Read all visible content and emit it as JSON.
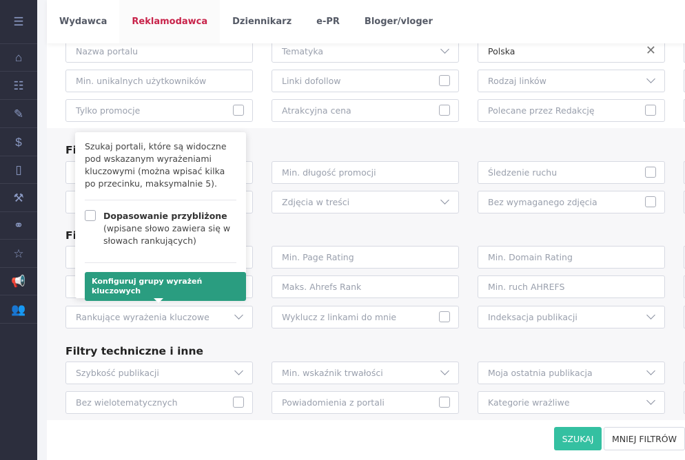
{
  "sidebar": {
    "items": [
      "menu-icon",
      "home-icon",
      "list-icon",
      "edit-icon",
      "invoice-icon",
      "clipboard-icon",
      "magic-wand-icon",
      "link-icon",
      "star-icon",
      "megaphone-icon",
      "users-icon"
    ],
    "glyphs": [
      "☰",
      "⌂",
      "☷",
      "✎",
      "$",
      "▯",
      "⚒",
      "⚭",
      "☆",
      "📢",
      "👥"
    ]
  },
  "tabs": [
    {
      "label": "Wydawca"
    },
    {
      "label": "Reklamodawca",
      "active": true
    },
    {
      "label": "Dziennikarz"
    },
    {
      "label": "e-PR"
    },
    {
      "label": "Bloger/vloger"
    }
  ],
  "accent": "#c8234a",
  "headings": [
    "Fi",
    "Fi",
    "Filtry techniczne i inne"
  ],
  "fields": [
    {
      "p": "Nazwa portalu",
      "c": ""
    },
    {
      "p": "Tematyka",
      "c": "chev"
    },
    {
      "p": "",
      "v": "Polska",
      "c": "clear"
    },
    {
      "p": "Min. unikalnych użytkowników",
      "c": ""
    },
    {
      "p": "Linki dofollow",
      "c": "cb"
    },
    {
      "p": "Rodzaj linków",
      "c": "chev"
    },
    {
      "p": "Tylko promocje",
      "c": "cb"
    },
    {
      "p": "Atrakcyjna cena",
      "c": "cb"
    },
    {
      "p": "Polecane przez Redakcję",
      "c": "cb"
    },
    {
      "p": "",
      "c": ""
    },
    {
      "p": "Min. długość promocji",
      "c": ""
    },
    {
      "p": "Śledzenie ruchu",
      "c": "cb"
    },
    {
      "p": "",
      "c": ""
    },
    {
      "p": "Zdjęcia w treści",
      "c": "chev"
    },
    {
      "p": "Bez wymaganego zdjęcia",
      "c": "cb"
    },
    {
      "p": "",
      "c": ""
    },
    {
      "p": "Min. Page Rating",
      "c": ""
    },
    {
      "p": "Min. Domain Rating",
      "c": ""
    },
    {
      "p": "",
      "c": ""
    },
    {
      "p": "Maks. Ahrefs Rank",
      "c": ""
    },
    {
      "p": "Min. ruch AHREFS",
      "c": ""
    },
    {
      "p": "Rankujące wyrażenia kluczowe",
      "c": "chev"
    },
    {
      "p": "Wyklucz z linkami do mnie",
      "c": "cb"
    },
    {
      "p": "Indeksacja publikacji",
      "c": "chev"
    },
    {
      "p": "Szybkość publikacji",
      "c": "chev"
    },
    {
      "p": "Min. wskaźnik trwałości",
      "c": "chev"
    },
    {
      "p": "Moja ostatnia publikacja",
      "c": "chev"
    },
    {
      "p": "Bez wielotematycznych",
      "c": "cb"
    },
    {
      "p": "Powiadomienia z portali",
      "c": "cb"
    },
    {
      "p": "Kategorie wrażliwe",
      "c": "chev"
    }
  ],
  "tooltip": {
    "text": "Szukaj portali, które są widoczne pod wskazanym wyrażeniami kluczowymi (można wpisać kilka po przecinku, maksymalnie 5).",
    "option_title": "Dopasowanie przybliżone",
    "option_desc": "(wpisane słowo zawiera się w słowach rankujących)",
    "button": "Konfiguruj grupy wyrażeń kluczowych"
  },
  "actions": {
    "search": "SZUKAJ",
    "less": "MNIEJ FILTRÓW"
  }
}
